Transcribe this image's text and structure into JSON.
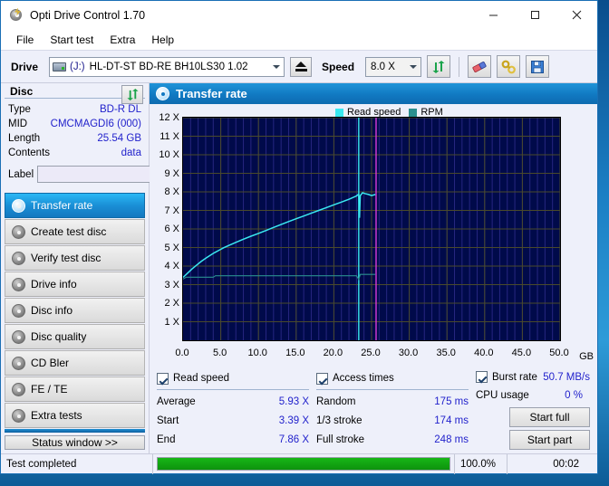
{
  "window": {
    "title": "Opti Drive Control 1.70",
    "icon": "disc-flash-icon",
    "minimize": "minimize-icon",
    "maximize": "maximize-icon",
    "close": "close-icon"
  },
  "menu": {
    "items": [
      "File",
      "Start test",
      "Extra",
      "Help"
    ]
  },
  "toolbar": {
    "drive_label": "Drive",
    "drive_letter": "(J:)",
    "drive_value": "HL-DT-ST BD-RE  BH10LS30 1.02",
    "eject_label": "eject-icon",
    "speed_label": "Speed",
    "speed_value": "8.0 X",
    "refresh_icon": "refresh-arrows-icon",
    "erase_icon": "eraser-icon",
    "tools_icon": "tools-icon",
    "save_icon": "save-floppy-icon"
  },
  "disc_panel": {
    "header": "Disc",
    "refresh_icon": "refresh-arrows-icon",
    "rows": [
      {
        "key": "Type",
        "value": "BD-R DL"
      },
      {
        "key": "MID",
        "value": "CMCMAGDI6 (000)"
      },
      {
        "key": "Length",
        "value": "25.54 GB"
      },
      {
        "key": "Contents",
        "value": "data"
      }
    ],
    "label_key": "Label",
    "label_value": "",
    "label_placeholder": "",
    "label_button_icon": "cd-disc-icon"
  },
  "sidebar": {
    "items": [
      {
        "label": "Transfer rate",
        "icon": "disc-speed-icon",
        "active": true
      },
      {
        "label": "Create test disc",
        "icon": "disc-write-icon",
        "active": false
      },
      {
        "label": "Verify test disc",
        "icon": "disc-verify-icon",
        "active": false
      },
      {
        "label": "Drive info",
        "icon": "disc-drive-icon",
        "active": false
      },
      {
        "label": "Disc info",
        "icon": "disc-info-icon",
        "active": false
      },
      {
        "label": "Disc quality",
        "icon": "disc-quality-icon",
        "active": false
      },
      {
        "label": "CD Bler",
        "icon": "disc-bler-icon",
        "active": false
      },
      {
        "label": "FE / TE",
        "icon": "disc-fete-icon",
        "active": false
      },
      {
        "label": "Extra tests",
        "icon": "disc-extra-icon",
        "active": false
      }
    ],
    "status_window_button": "Status window >>"
  },
  "content": {
    "header_title": "Transfer rate",
    "header_icon": "disc-speed-icon"
  },
  "chart_data": {
    "type": "line",
    "title": "Transfer rate",
    "xlabel": "GB",
    "ylabel": "X",
    "xlim": [
      0.0,
      50.0
    ],
    "ylim": [
      0,
      12
    ],
    "x_unit": "GB",
    "grid": true,
    "legend_position": "top-left",
    "x_ticks": [
      "0.0",
      "5.0",
      "10.0",
      "15.0",
      "20.0",
      "25.0",
      "30.0",
      "35.0",
      "40.0",
      "45.0",
      "50.0"
    ],
    "x_tick_values": [
      0,
      5,
      10,
      15,
      20,
      25,
      30,
      35,
      40,
      45,
      50
    ],
    "y_ticks": [
      "1 X",
      "2 X",
      "3 X",
      "4 X",
      "5 X",
      "6 X",
      "7 X",
      "8 X",
      "9 X",
      "10 X",
      "11 X",
      "12 X"
    ],
    "y_tick_values": [
      1,
      2,
      3,
      4,
      5,
      6,
      7,
      8,
      9,
      10,
      11,
      12
    ],
    "plot_bg": "#000a4a",
    "grid_color": "#4a4a2a",
    "legend": [
      {
        "name": "Read speed",
        "color": "#3ae8f0"
      },
      {
        "name": "RPM",
        "color": "#2a8f8f"
      }
    ],
    "series": [
      {
        "name": "Read speed",
        "color": "#3ae8f0",
        "points": [
          [
            0.0,
            3.39
          ],
          [
            0.6,
            3.62
          ],
          [
            1.2,
            3.85
          ],
          [
            1.8,
            4.05
          ],
          [
            2.4,
            4.25
          ],
          [
            3.0,
            4.42
          ],
          [
            3.6,
            4.58
          ],
          [
            4.2,
            4.73
          ],
          [
            4.8,
            4.86
          ],
          [
            5.4,
            4.99
          ],
          [
            6.0,
            5.1
          ],
          [
            7.0,
            5.28
          ],
          [
            8.0,
            5.45
          ],
          [
            9.0,
            5.61
          ],
          [
            10.0,
            5.76
          ],
          [
            11.0,
            5.92
          ],
          [
            12.0,
            6.08
          ],
          [
            13.0,
            6.24
          ],
          [
            14.0,
            6.4
          ],
          [
            15.0,
            6.55
          ],
          [
            16.0,
            6.7
          ],
          [
            17.0,
            6.85
          ],
          [
            18.0,
            7.0
          ],
          [
            19.0,
            7.15
          ],
          [
            20.0,
            7.3
          ],
          [
            21.0,
            7.45
          ],
          [
            22.0,
            7.6
          ],
          [
            23.0,
            7.78
          ],
          [
            23.3,
            7.88
          ],
          [
            23.4,
            6.6
          ],
          [
            23.5,
            7.8
          ],
          [
            23.8,
            7.95
          ],
          [
            24.2,
            7.9
          ],
          [
            24.6,
            7.86
          ],
          [
            25.0,
            7.8
          ],
          [
            25.5,
            7.86
          ]
        ]
      },
      {
        "name": "RPM",
        "color": "#2a8f8f",
        "points": [
          [
            0.0,
            3.3
          ],
          [
            0.4,
            3.4
          ],
          [
            4.0,
            3.4
          ],
          [
            4.3,
            3.48
          ],
          [
            23.0,
            3.48
          ],
          [
            23.3,
            3.28
          ],
          [
            23.5,
            3.55
          ],
          [
            25.5,
            3.55
          ]
        ]
      }
    ],
    "markers": [
      {
        "name": "cursor-line",
        "x": 23.3,
        "color": "#3ae8f0"
      },
      {
        "name": "disc-end-line",
        "x": 25.6,
        "color": "#d83ad8"
      }
    ]
  },
  "results": {
    "read_speed": {
      "checkbox_label": "Read speed",
      "checked": true,
      "rows": [
        {
          "key": "Average",
          "value": "5.93 X"
        },
        {
          "key": "Start",
          "value": "3.39 X"
        },
        {
          "key": "End",
          "value": "7.86 X"
        }
      ]
    },
    "access_times": {
      "checkbox_label": "Access times",
      "checked": true,
      "rows": [
        {
          "key": "Random",
          "value": "175 ms"
        },
        {
          "key": "1/3 stroke",
          "value": "174 ms"
        },
        {
          "key": "Full stroke",
          "value": "248 ms"
        }
      ]
    },
    "burst": {
      "checkbox_label": "Burst rate",
      "checked": true,
      "burst_value": "50.7 MB/s",
      "cpu_key": "CPU usage",
      "cpu_value": "0 %",
      "start_full": "Start full",
      "start_part": "Start part"
    }
  },
  "statusbar": {
    "message": "Test completed",
    "percent_text": "100.0%",
    "percent_value": 100,
    "elapsed": "00:02"
  },
  "colors": {
    "accent": "#1179c2",
    "value_text": "#2222cc",
    "progress": "#0d930d",
    "read_speed": "#3ae8f0",
    "rpm": "#2a8f8f",
    "plot_bg": "#000a4a"
  }
}
